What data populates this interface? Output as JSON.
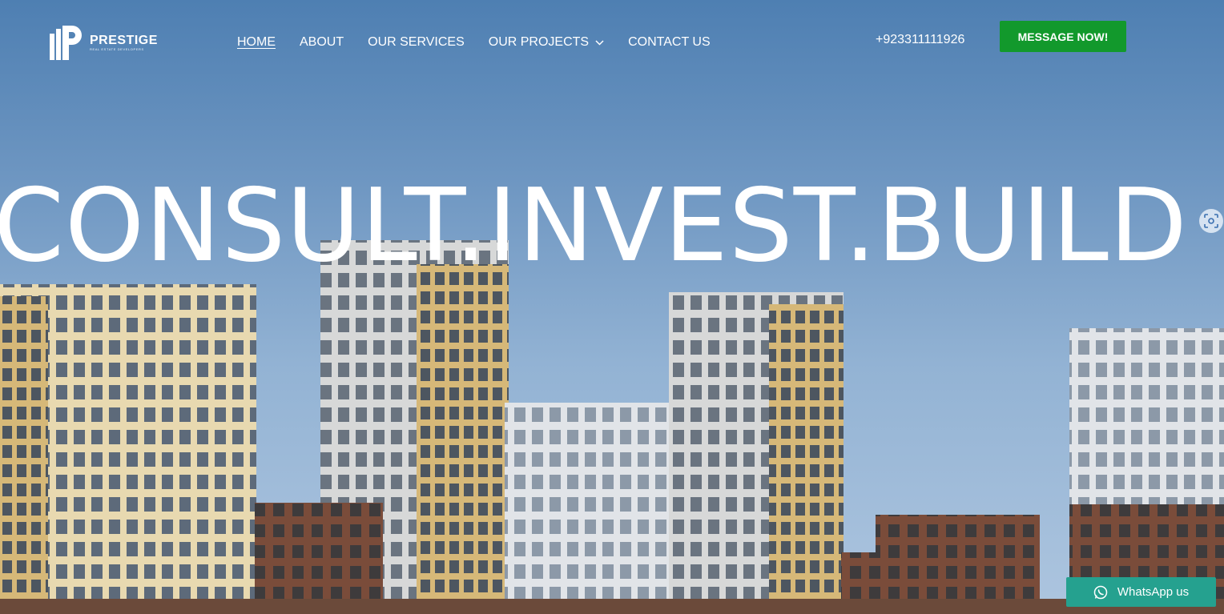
{
  "brand": {
    "name": "PRESTIGE",
    "tagline": "REAL ESTATE DEVELOPERS"
  },
  "nav": {
    "items": [
      {
        "label": "HOME",
        "active": true
      },
      {
        "label": "ABOUT"
      },
      {
        "label": "OUR SERVICES"
      },
      {
        "label": "OUR PROJECTS",
        "dropdown": true
      },
      {
        "label": "CONTACT US"
      }
    ]
  },
  "header": {
    "phone": "+923311111926",
    "cta_label": "MESSAGE NOW!"
  },
  "hero": {
    "headline": "CONSULT.INVEST.BUILD"
  },
  "whatsapp": {
    "label": "WhatsApp us"
  },
  "colors": {
    "cta": "#12992c",
    "whatsapp": "#25a18f",
    "sky": "#6f97c2"
  },
  "icons": {
    "scan": "scan-icon",
    "whatsapp": "whatsapp-icon",
    "dropdown": "chevron-down-icon"
  }
}
